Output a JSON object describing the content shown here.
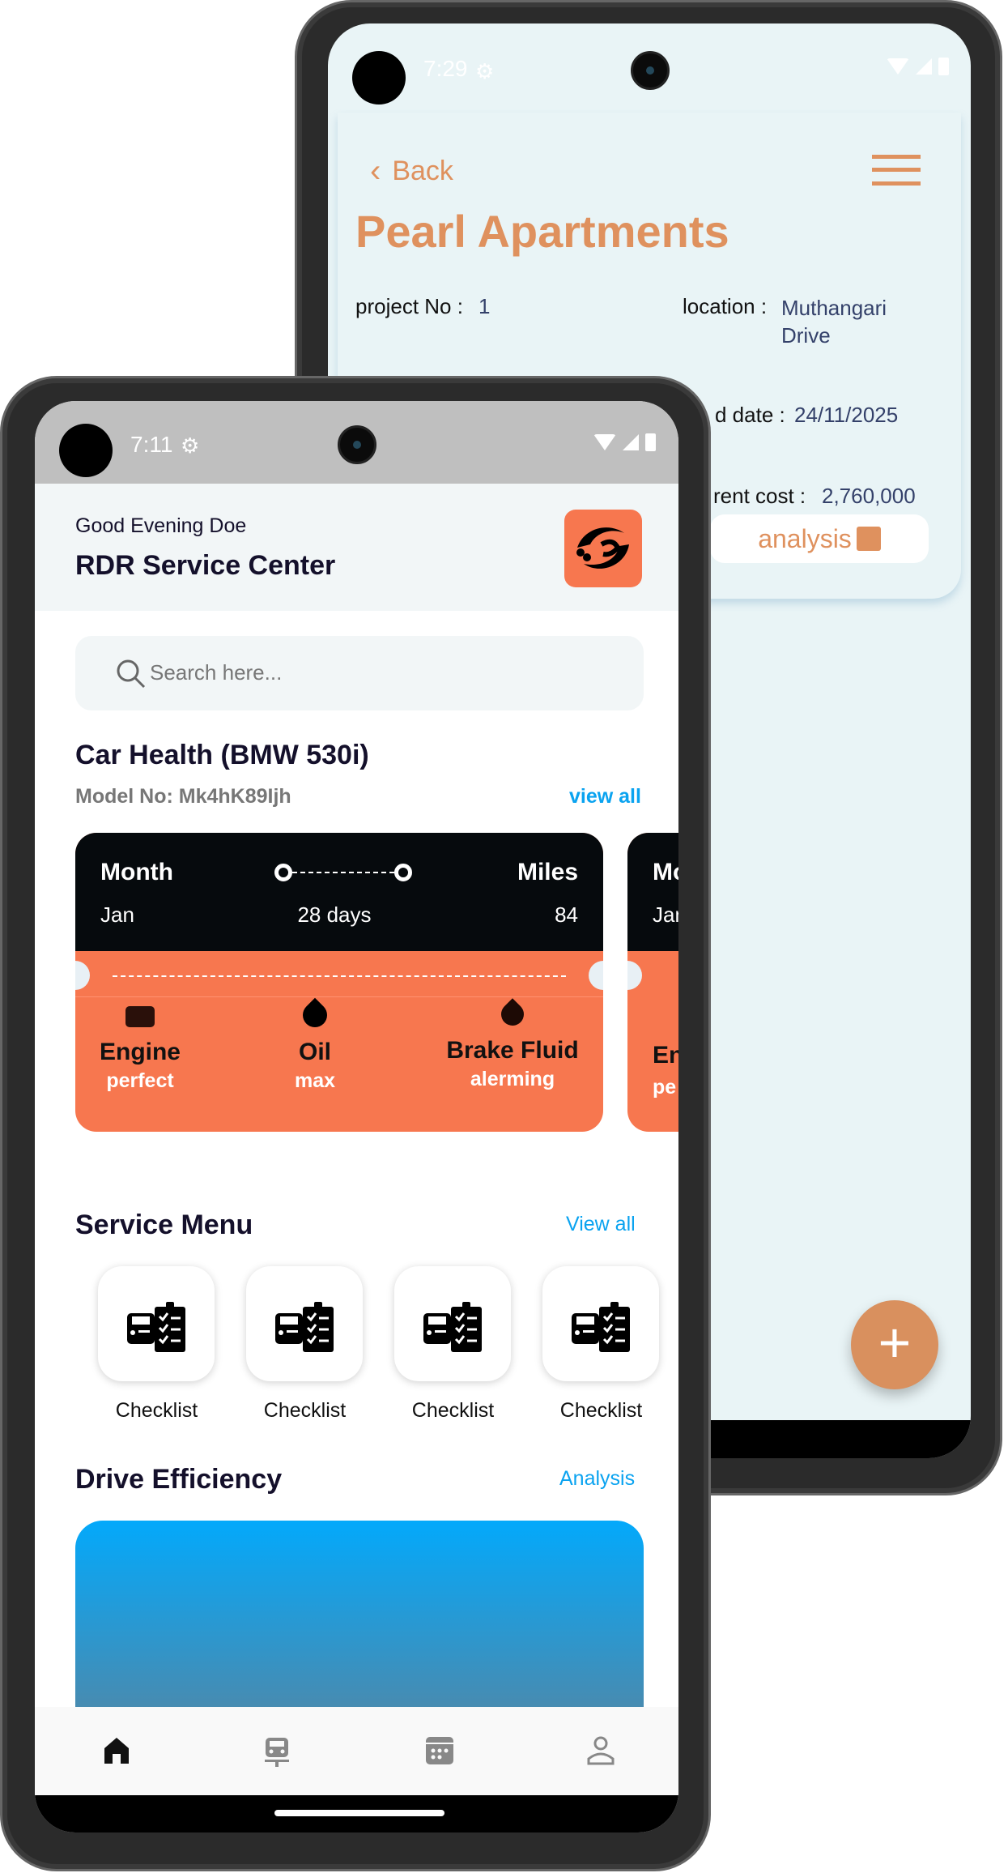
{
  "back_phone": {
    "status": {
      "time": "7:29"
    },
    "back_label": "Back",
    "title": "Pearl Apartments",
    "fields": {
      "project_no_label": "project No :",
      "project_no": "1",
      "location_label": "location :",
      "location": "Muthangari Drive",
      "date_label": "d date :",
      "date": "24/11/2025",
      "cost_label": "rent cost :",
      "cost": "2,760,000"
    },
    "analysis_button": "analysis",
    "accent": "#df915e"
  },
  "front_phone": {
    "status": {
      "time": "7:11"
    },
    "header": {
      "greeting": "Good Evening Doe",
      "title": "RDR Service Center"
    },
    "search": {
      "placeholder": "Search here..."
    },
    "car_health": {
      "title": "Car Health (BMW 530i)",
      "model": "Model No: Mk4hK89Ijh",
      "view_all": "view all",
      "cards": [
        {
          "month_label": "Month",
          "month": "Jan",
          "duration": "28 days",
          "miles_label": "Miles",
          "miles": "84",
          "items": [
            {
              "name": "Engine",
              "status": "perfect",
              "icon": "engine-icon"
            },
            {
              "name": "Oil",
              "status": "max",
              "icon": "oil-drop-icon"
            },
            {
              "name": "Brake Fluid",
              "status": "alerming",
              "icon": "drop-icon"
            }
          ]
        },
        {
          "month_label": "Mo",
          "month": "Jan",
          "engine": "En",
          "status": "pe"
        }
      ]
    },
    "service_menu": {
      "title": "Service Menu",
      "view_all": "View all",
      "items": [
        "Checklist",
        "Checklist",
        "Checklist",
        "Checklist"
      ]
    },
    "drive_efficiency": {
      "title": "Drive Efficiency",
      "analysis": "Analysis"
    },
    "bottom_nav": [
      "home-icon",
      "car-icon",
      "calendar-icon",
      "profile-icon"
    ],
    "accent": "#f7774f",
    "link_color": "#0aa3f0"
  }
}
